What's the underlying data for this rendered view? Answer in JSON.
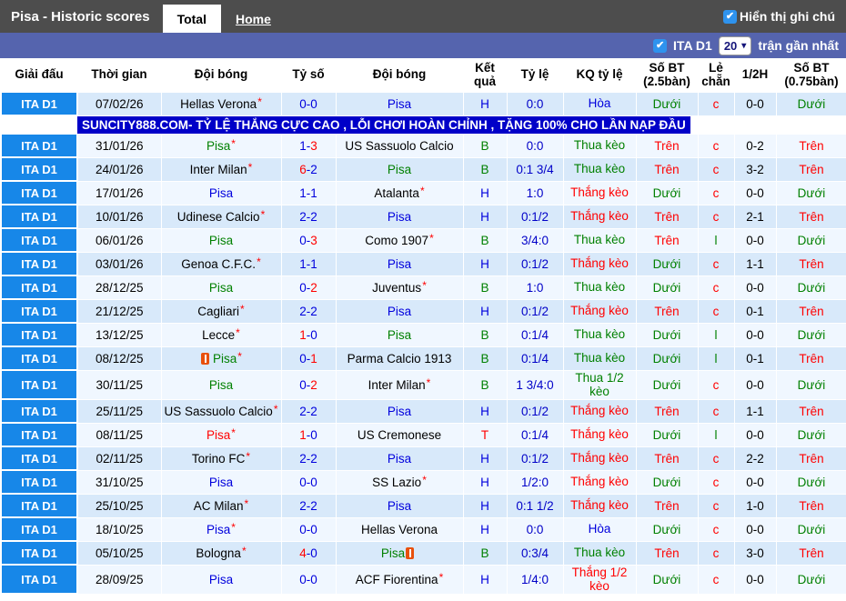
{
  "title_bar": {
    "title": "Pisa - Historic scores",
    "tabs": [
      {
        "label": "Total",
        "active": true
      },
      {
        "label": "Home",
        "active": false
      }
    ],
    "note_toggle": {
      "label": "Hiển thị ghi chú",
      "checked": true
    }
  },
  "filter_bar": {
    "league_toggle": {
      "label": "ITA D1",
      "checked": true
    },
    "recent_select": {
      "value": "20"
    },
    "recent_suffix": "trận gần nhất"
  },
  "banner": {
    "text": "SUNCITY888.COM- TỶ LỆ THẮNG CỰC CAO , LỖI CHƠI HOÀN CHỈNH , TẶNG 100% CHO LẦN NẠP ĐẦU"
  },
  "glyphs": {
    "star": "*",
    "check": "✔",
    "chevron": "▾",
    "score_sep": "-"
  },
  "colors": {
    "win_red": "#FF0000",
    "loss_green": "#008000",
    "draw_blue": "#0000DD",
    "league_badge_bg": "#1787E8",
    "row_dark": "#D8E9FA",
    "row_light": "#F0F7FF",
    "title_bar_bg": "#4D4D4D",
    "filter_bar_bg": "#5564AE",
    "banner_bg": "#0000C8",
    "checkbox_blue": "#2E93EE"
  },
  "columns": [
    "Giải đấu",
    "Thời gian",
    "Đội bóng",
    "Tỷ số",
    "Đội bóng",
    "Kết quả",
    "Tỷ lệ",
    "KQ tỷ lệ",
    "Số BT (2.5bàn)",
    "Lẻ chẵn",
    "1/2H",
    "Số BT (0.75bàn)"
  ],
  "rows": [
    {
      "league": "ITA D1",
      "d": "07/02/26",
      "h": {
        "n": "Hellas Verona",
        "c": "black",
        "star": true
      },
      "s": {
        "h": "0",
        "a": "0",
        "hc": "blue",
        "ac": "blue"
      },
      "a": {
        "n": "Pisa",
        "c": "blue",
        "star": false
      },
      "r": {
        "t": "H",
        "c": "blue"
      },
      "o": "0:0",
      "kq": {
        "t": "Hòa",
        "c": "blue"
      },
      "bt25": {
        "t": "Dưới",
        "c": "green"
      },
      "oe": {
        "t": "c",
        "c": "red"
      },
      "h2": "0-0",
      "bt075": {
        "t": "Dưới",
        "c": "green"
      },
      "shade": "dark"
    },
    {
      "type": "ad"
    },
    {
      "league": "ITA D1",
      "d": "31/01/26",
      "h": {
        "n": "Pisa",
        "c": "green",
        "star": true
      },
      "s": {
        "h": "1",
        "a": "3",
        "hc": "blue",
        "ac": "red"
      },
      "a": {
        "n": "US Sassuolo Calcio",
        "c": "black",
        "star": false
      },
      "r": {
        "t": "B",
        "c": "green"
      },
      "o": "0:0",
      "kq": {
        "t": "Thua kèo",
        "c": "green"
      },
      "bt25": {
        "t": "Trên",
        "c": "red"
      },
      "oe": {
        "t": "c",
        "c": "red"
      },
      "h2": "0-2",
      "bt075": {
        "t": "Trên",
        "c": "red"
      },
      "shade": "light"
    },
    {
      "league": "ITA D1",
      "d": "24/01/26",
      "h": {
        "n": "Inter Milan",
        "c": "black",
        "star": true
      },
      "s": {
        "h": "6",
        "a": "2",
        "hc": "red",
        "ac": "blue"
      },
      "a": {
        "n": "Pisa",
        "c": "green",
        "star": false
      },
      "r": {
        "t": "B",
        "c": "green"
      },
      "o": "0:1 3/4",
      "kq": {
        "t": "Thua kèo",
        "c": "green"
      },
      "bt25": {
        "t": "Trên",
        "c": "red"
      },
      "oe": {
        "t": "c",
        "c": "red"
      },
      "h2": "3-2",
      "bt075": {
        "t": "Trên",
        "c": "red"
      },
      "shade": "dark"
    },
    {
      "league": "ITA D1",
      "d": "17/01/26",
      "h": {
        "n": "Pisa",
        "c": "blue",
        "star": false
      },
      "s": {
        "h": "1",
        "a": "1",
        "hc": "blue",
        "ac": "blue"
      },
      "a": {
        "n": "Atalanta",
        "c": "black",
        "star": true
      },
      "r": {
        "t": "H",
        "c": "blue"
      },
      "o": "1:0",
      "kq": {
        "t": "Thắng kèo",
        "c": "red"
      },
      "bt25": {
        "t": "Dưới",
        "c": "green"
      },
      "oe": {
        "t": "c",
        "c": "red"
      },
      "h2": "0-0",
      "bt075": {
        "t": "Dưới",
        "c": "green"
      },
      "shade": "light"
    },
    {
      "league": "ITA D1",
      "d": "10/01/26",
      "h": {
        "n": "Udinese Calcio",
        "c": "black",
        "star": true
      },
      "s": {
        "h": "2",
        "a": "2",
        "hc": "blue",
        "ac": "blue"
      },
      "a": {
        "n": "Pisa",
        "c": "blue",
        "star": false
      },
      "r": {
        "t": "H",
        "c": "blue"
      },
      "o": "0:1/2",
      "kq": {
        "t": "Thắng kèo",
        "c": "red"
      },
      "bt25": {
        "t": "Trên",
        "c": "red"
      },
      "oe": {
        "t": "c",
        "c": "red"
      },
      "h2": "2-1",
      "bt075": {
        "t": "Trên",
        "c": "red"
      },
      "shade": "dark"
    },
    {
      "league": "ITA D1",
      "d": "06/01/26",
      "h": {
        "n": "Pisa",
        "c": "green",
        "star": false
      },
      "s": {
        "h": "0",
        "a": "3",
        "hc": "blue",
        "ac": "red"
      },
      "a": {
        "n": "Como 1907",
        "c": "black",
        "star": true
      },
      "r": {
        "t": "B",
        "c": "green"
      },
      "o": "3/4:0",
      "kq": {
        "t": "Thua kèo",
        "c": "green"
      },
      "bt25": {
        "t": "Trên",
        "c": "red"
      },
      "oe": {
        "t": "l",
        "c": "green"
      },
      "h2": "0-0",
      "bt075": {
        "t": "Dưới",
        "c": "green"
      },
      "shade": "light"
    },
    {
      "league": "ITA D1",
      "d": "03/01/26",
      "h": {
        "n": "Genoa C.F.C.",
        "c": "black",
        "star": true
      },
      "s": {
        "h": "1",
        "a": "1",
        "hc": "blue",
        "ac": "blue"
      },
      "a": {
        "n": "Pisa",
        "c": "blue",
        "star": false
      },
      "r": {
        "t": "H",
        "c": "blue"
      },
      "o": "0:1/2",
      "kq": {
        "t": "Thắng kèo",
        "c": "red"
      },
      "bt25": {
        "t": "Dưới",
        "c": "green"
      },
      "oe": {
        "t": "c",
        "c": "red"
      },
      "h2": "1-1",
      "bt075": {
        "t": "Trên",
        "c": "red"
      },
      "shade": "dark"
    },
    {
      "league": "ITA D1",
      "d": "28/12/25",
      "h": {
        "n": "Pisa",
        "c": "green",
        "star": false
      },
      "s": {
        "h": "0",
        "a": "2",
        "hc": "blue",
        "ac": "red"
      },
      "a": {
        "n": "Juventus",
        "c": "black",
        "star": true
      },
      "r": {
        "t": "B",
        "c": "green"
      },
      "o": "1:0",
      "kq": {
        "t": "Thua kèo",
        "c": "green"
      },
      "bt25": {
        "t": "Dưới",
        "c": "green"
      },
      "oe": {
        "t": "c",
        "c": "red"
      },
      "h2": "0-0",
      "bt075": {
        "t": "Dưới",
        "c": "green"
      },
      "shade": "light"
    },
    {
      "league": "ITA D1",
      "d": "21/12/25",
      "h": {
        "n": "Cagliari",
        "c": "black",
        "star": true
      },
      "s": {
        "h": "2",
        "a": "2",
        "hc": "blue",
        "ac": "blue"
      },
      "a": {
        "n": "Pisa",
        "c": "blue",
        "star": false
      },
      "r": {
        "t": "H",
        "c": "blue"
      },
      "o": "0:1/2",
      "kq": {
        "t": "Thắng kèo",
        "c": "red"
      },
      "bt25": {
        "t": "Trên",
        "c": "red"
      },
      "oe": {
        "t": "c",
        "c": "red"
      },
      "h2": "0-1",
      "bt075": {
        "t": "Trên",
        "c": "red"
      },
      "shade": "dark"
    },
    {
      "league": "ITA D1",
      "d": "13/12/25",
      "h": {
        "n": "Lecce",
        "c": "black",
        "star": true
      },
      "s": {
        "h": "1",
        "a": "0",
        "hc": "red",
        "ac": "blue"
      },
      "a": {
        "n": "Pisa",
        "c": "green",
        "star": false
      },
      "r": {
        "t": "B",
        "c": "green"
      },
      "o": "0:1/4",
      "kq": {
        "t": "Thua kèo",
        "c": "green"
      },
      "bt25": {
        "t": "Dưới",
        "c": "green"
      },
      "oe": {
        "t": "l",
        "c": "green"
      },
      "h2": "0-0",
      "bt075": {
        "t": "Dưới",
        "c": "green"
      },
      "shade": "light"
    },
    {
      "league": "ITA D1",
      "d": "08/12/25",
      "h": {
        "n": "Pisa",
        "c": "green",
        "star": true,
        "card": "before"
      },
      "s": {
        "h": "0",
        "a": "1",
        "hc": "blue",
        "ac": "red"
      },
      "a": {
        "n": "Parma Calcio 1913",
        "c": "black",
        "star": false
      },
      "r": {
        "t": "B",
        "c": "green"
      },
      "o": "0:1/4",
      "kq": {
        "t": "Thua kèo",
        "c": "green"
      },
      "bt25": {
        "t": "Dưới",
        "c": "green"
      },
      "oe": {
        "t": "l",
        "c": "green"
      },
      "h2": "0-1",
      "bt075": {
        "t": "Trên",
        "c": "red"
      },
      "shade": "dark"
    },
    {
      "league": "ITA D1",
      "d": "30/11/25",
      "h": {
        "n": "Pisa",
        "c": "green",
        "star": false
      },
      "s": {
        "h": "0",
        "a": "2",
        "hc": "blue",
        "ac": "red"
      },
      "a": {
        "n": "Inter Milan",
        "c": "black",
        "star": true
      },
      "r": {
        "t": "B",
        "c": "green"
      },
      "o": "1 3/4:0",
      "kq": {
        "t": "Thua 1/2 kèo",
        "c": "green"
      },
      "bt25": {
        "t": "Dưới",
        "c": "green"
      },
      "oe": {
        "t": "c",
        "c": "red"
      },
      "h2": "0-0",
      "bt075": {
        "t": "Dưới",
        "c": "green"
      },
      "shade": "light"
    },
    {
      "league": "ITA D1",
      "d": "25/11/25",
      "h": {
        "n": "US Sassuolo Calcio",
        "c": "black",
        "star": true
      },
      "s": {
        "h": "2",
        "a": "2",
        "hc": "blue",
        "ac": "blue"
      },
      "a": {
        "n": "Pisa",
        "c": "blue",
        "star": false
      },
      "r": {
        "t": "H",
        "c": "blue"
      },
      "o": "0:1/2",
      "kq": {
        "t": "Thắng kèo",
        "c": "red"
      },
      "bt25": {
        "t": "Trên",
        "c": "red"
      },
      "oe": {
        "t": "c",
        "c": "red"
      },
      "h2": "1-1",
      "bt075": {
        "t": "Trên",
        "c": "red"
      },
      "shade": "dark"
    },
    {
      "league": "ITA D1",
      "d": "08/11/25",
      "h": {
        "n": "Pisa",
        "c": "red",
        "star": true
      },
      "s": {
        "h": "1",
        "a": "0",
        "hc": "red",
        "ac": "blue"
      },
      "a": {
        "n": "US Cremonese",
        "c": "black",
        "star": false
      },
      "r": {
        "t": "T",
        "c": "red"
      },
      "o": "0:1/4",
      "kq": {
        "t": "Thắng kèo",
        "c": "red"
      },
      "bt25": {
        "t": "Dưới",
        "c": "green"
      },
      "oe": {
        "t": "l",
        "c": "green"
      },
      "h2": "0-0",
      "bt075": {
        "t": "Dưới",
        "c": "green"
      },
      "shade": "light"
    },
    {
      "league": "ITA D1",
      "d": "02/11/25",
      "h": {
        "n": "Torino FC",
        "c": "black",
        "star": true
      },
      "s": {
        "h": "2",
        "a": "2",
        "hc": "blue",
        "ac": "blue"
      },
      "a": {
        "n": "Pisa",
        "c": "blue",
        "star": false
      },
      "r": {
        "t": "H",
        "c": "blue"
      },
      "o": "0:1/2",
      "kq": {
        "t": "Thắng kèo",
        "c": "red"
      },
      "bt25": {
        "t": "Trên",
        "c": "red"
      },
      "oe": {
        "t": "c",
        "c": "red"
      },
      "h2": "2-2",
      "bt075": {
        "t": "Trên",
        "c": "red"
      },
      "shade": "dark"
    },
    {
      "league": "ITA D1",
      "d": "31/10/25",
      "h": {
        "n": "Pisa",
        "c": "blue",
        "star": false
      },
      "s": {
        "h": "0",
        "a": "0",
        "hc": "blue",
        "ac": "blue"
      },
      "a": {
        "n": "SS Lazio",
        "c": "black",
        "star": true
      },
      "r": {
        "t": "H",
        "c": "blue"
      },
      "o": "1/2:0",
      "kq": {
        "t": "Thắng kèo",
        "c": "red"
      },
      "bt25": {
        "t": "Dưới",
        "c": "green"
      },
      "oe": {
        "t": "c",
        "c": "red"
      },
      "h2": "0-0",
      "bt075": {
        "t": "Dưới",
        "c": "green"
      },
      "shade": "light"
    },
    {
      "league": "ITA D1",
      "d": "25/10/25",
      "h": {
        "n": "AC Milan",
        "c": "black",
        "star": true
      },
      "s": {
        "h": "2",
        "a": "2",
        "hc": "blue",
        "ac": "blue"
      },
      "a": {
        "n": "Pisa",
        "c": "blue",
        "star": false
      },
      "r": {
        "t": "H",
        "c": "blue"
      },
      "o": "0:1 1/2",
      "kq": {
        "t": "Thắng kèo",
        "c": "red"
      },
      "bt25": {
        "t": "Trên",
        "c": "red"
      },
      "oe": {
        "t": "c",
        "c": "red"
      },
      "h2": "1-0",
      "bt075": {
        "t": "Trên",
        "c": "red"
      },
      "shade": "dark"
    },
    {
      "league": "ITA D1",
      "d": "18/10/25",
      "h": {
        "n": "Pisa",
        "c": "blue",
        "star": true
      },
      "s": {
        "h": "0",
        "a": "0",
        "hc": "blue",
        "ac": "blue"
      },
      "a": {
        "n": "Hellas Verona",
        "c": "black",
        "star": false
      },
      "r": {
        "t": "H",
        "c": "blue"
      },
      "o": "0:0",
      "kq": {
        "t": "Hòa",
        "c": "blue"
      },
      "bt25": {
        "t": "Dưới",
        "c": "green"
      },
      "oe": {
        "t": "c",
        "c": "red"
      },
      "h2": "0-0",
      "bt075": {
        "t": "Dưới",
        "c": "green"
      },
      "shade": "light"
    },
    {
      "league": "ITA D1",
      "d": "05/10/25",
      "h": {
        "n": "Bologna",
        "c": "black",
        "star": true
      },
      "s": {
        "h": "4",
        "a": "0",
        "hc": "red",
        "ac": "blue"
      },
      "a": {
        "n": "Pisa",
        "c": "green",
        "star": false,
        "card": "after"
      },
      "r": {
        "t": "B",
        "c": "green"
      },
      "o": "0:3/4",
      "kq": {
        "t": "Thua kèo",
        "c": "green"
      },
      "bt25": {
        "t": "Trên",
        "c": "red"
      },
      "oe": {
        "t": "c",
        "c": "red"
      },
      "h2": "3-0",
      "bt075": {
        "t": "Trên",
        "c": "red"
      },
      "shade": "dark"
    },
    {
      "league": "ITA D1",
      "d": "28/09/25",
      "h": {
        "n": "Pisa",
        "c": "blue",
        "star": false
      },
      "s": {
        "h": "0",
        "a": "0",
        "hc": "blue",
        "ac": "blue"
      },
      "a": {
        "n": "ACF Fiorentina",
        "c": "black",
        "star": true
      },
      "r": {
        "t": "H",
        "c": "blue"
      },
      "o": "1/4:0",
      "kq": {
        "t": "Thắng 1/2 kèo",
        "c": "red"
      },
      "bt25": {
        "t": "Dưới",
        "c": "green"
      },
      "oe": {
        "t": "c",
        "c": "red"
      },
      "h2": "0-0",
      "bt075": {
        "t": "Dưới",
        "c": "green"
      },
      "shade": "light"
    }
  ]
}
